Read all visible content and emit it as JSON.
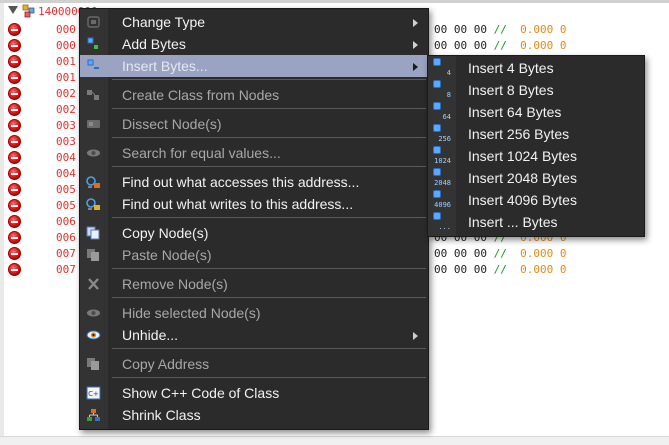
{
  "background": {
    "header_text": "140000000",
    "rows": [
      {
        "addr": "000",
        "hex": "00 00 00",
        "comment": "//",
        "value": "0.000 0"
      },
      {
        "addr": "000",
        "hex": "00 00 00",
        "comment": "//",
        "value": "0.000 0"
      },
      {
        "addr": "001",
        "hex": "",
        "comment": "",
        "value": ""
      },
      {
        "addr": "001",
        "hex": "",
        "comment": "",
        "value": ""
      },
      {
        "addr": "002",
        "hex": "",
        "comment": "",
        "value": ""
      },
      {
        "addr": "002",
        "hex": "",
        "comment": "",
        "value": ""
      },
      {
        "addr": "003",
        "hex": "",
        "comment": "",
        "value": ""
      },
      {
        "addr": "003",
        "hex": "",
        "comment": "",
        "value": ""
      },
      {
        "addr": "004",
        "hex": "",
        "comment": "",
        "value": ""
      },
      {
        "addr": "004",
        "hex": "",
        "comment": "",
        "value": ""
      },
      {
        "addr": "005",
        "hex": "",
        "comment": "",
        "value": ""
      },
      {
        "addr": "005",
        "hex": "",
        "comment": "",
        "value": ""
      },
      {
        "addr": "006",
        "hex": "",
        "comment": "",
        "value": ""
      },
      {
        "addr": "006",
        "hex": "00 00 00",
        "comment": "//",
        "value": "0.000 0"
      },
      {
        "addr": "007",
        "hex": "00 00 00",
        "comment": "//",
        "value": "0.000 0"
      },
      {
        "addr": "007",
        "hex": "00 00 00",
        "comment": "//",
        "value": "0.000 0"
      }
    ]
  },
  "menu": {
    "items": [
      {
        "label": "Change Type",
        "disabled": false
      },
      {
        "label": "Add Bytes",
        "disabled": false
      },
      {
        "label": "Insert Bytes...",
        "disabled": false
      },
      {
        "label": "Create Class from Nodes",
        "disabled": true
      },
      {
        "label": "Dissect Node(s)",
        "disabled": true
      },
      {
        "label": "Search for equal values...",
        "disabled": true
      },
      {
        "label": "Find out what accesses this address...",
        "disabled": false
      },
      {
        "label": "Find out what writes to this address...",
        "disabled": false
      },
      {
        "label": "Copy Node(s)",
        "disabled": false
      },
      {
        "label": "Paste Node(s)",
        "disabled": true
      },
      {
        "label": "Remove Node(s)",
        "disabled": true
      },
      {
        "label": "Hide selected Node(s)",
        "disabled": true
      },
      {
        "label": "Unhide...",
        "disabled": false
      },
      {
        "label": "Copy Address",
        "disabled": true
      },
      {
        "label": "Show C++ Code of Class",
        "disabled": false
      },
      {
        "label": "Shrink Class",
        "disabled": false
      }
    ]
  },
  "submenu": {
    "items": [
      {
        "label": "Insert 4 Bytes",
        "icon_num": "4"
      },
      {
        "label": "Insert 8 Bytes",
        "icon_num": "8"
      },
      {
        "label": "Insert 64 Bytes",
        "icon_num": "64"
      },
      {
        "label": "Insert 256 Bytes",
        "icon_num": "256"
      },
      {
        "label": "Insert 1024 Bytes",
        "icon_num": "1024"
      },
      {
        "label": "Insert 2048 Bytes",
        "icon_num": "2048"
      },
      {
        "label": "Insert 4096 Bytes",
        "icon_num": "4096"
      },
      {
        "label": "Insert ... Bytes",
        "icon_num": "..."
      }
    ]
  },
  "colors": {
    "menu_bg": "#2b2b2b",
    "highlight": "#9aa3c2",
    "address_red": "#e03030",
    "comment_green": "#1a9a1a",
    "value_orange": "#e08a1a"
  }
}
